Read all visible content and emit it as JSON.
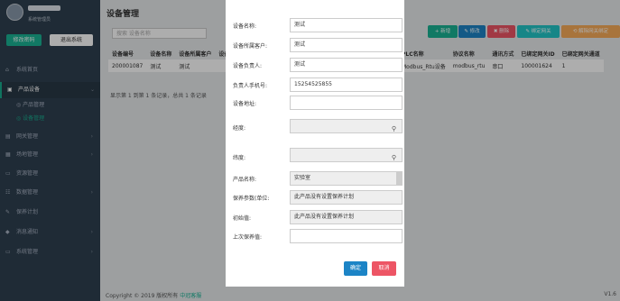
{
  "sidebar": {
    "role": "系统管理员",
    "edit_profile": "修改密码",
    "logout": "退出系统",
    "items": [
      {
        "icon": "home-icon",
        "glyph": "⌂",
        "label": "系统首页"
      },
      {
        "icon": "box-icon",
        "glyph": "▣",
        "label": "产品设备"
      },
      {
        "icon": "network-icon",
        "glyph": "▤",
        "label": "网关管理"
      },
      {
        "icon": "layers-icon",
        "glyph": "▦",
        "label": "场地管理"
      },
      {
        "icon": "monitor-icon",
        "glyph": "▭",
        "label": "资源管理"
      },
      {
        "icon": "grid-icon",
        "glyph": "☷",
        "label": "数据管理"
      },
      {
        "icon": "wrench-icon",
        "glyph": "✎",
        "label": "保养计划"
      },
      {
        "icon": "bell-icon",
        "glyph": "◆",
        "label": "消息通知"
      },
      {
        "icon": "desktop-icon",
        "glyph": "▭",
        "label": "系统管理"
      }
    ],
    "sub_items": [
      {
        "label": "产品管理"
      },
      {
        "label": "设备管理"
      }
    ]
  },
  "main": {
    "title": "设备管理",
    "search_placeholder": "搜索 设备名称",
    "toolbar": {
      "add": "+ 新增",
      "edit": "✎ 修改",
      "delete": "✖ 删除",
      "bind": "✎ 绑定网关",
      "unbind": "⟲ 解除网关绑定"
    },
    "columns_left": [
      "设备编号",
      "设备名称",
      "设备所属客户",
      "设备负责人"
    ],
    "row_left": [
      "200001087",
      "测试",
      "测试",
      ""
    ],
    "columns_right": [
      "PLC名称",
      "协议名称",
      "通讯方式",
      "已绑定网关ID",
      "已绑定网关通道"
    ],
    "row_right": [
      "Modbus_Rtu设备",
      "modbus_rtu",
      "串口",
      "100001624",
      "1"
    ],
    "pager": "显示第 1 到第 1 条记录，总共 1 条记录",
    "footer_prefix": "Copyright © 2019 版权所有 ",
    "footer_link": "中冠客服",
    "version": "V1.6"
  },
  "modal": {
    "fields": [
      {
        "label": "设备名称:",
        "value": "测试"
      },
      {
        "label": "设备所属客户:",
        "value": "测试"
      },
      {
        "label": "设备负责人:",
        "value": "测试"
      },
      {
        "label": "负责人手机号:",
        "value": "15254525855"
      },
      {
        "label": "设备地址:",
        "value": ""
      },
      {
        "label": "经度:",
        "value": ""
      },
      {
        "label": "纬度:",
        "value": ""
      },
      {
        "label": "产品名称:",
        "value": "实验室"
      },
      {
        "label": "保养参数(单位:",
        "value": "此产品没有设置保养计划"
      },
      {
        "label": "初始值:",
        "value": "此产品没有设置保养计划"
      },
      {
        "label": "上次保养值:",
        "value": ""
      }
    ],
    "confirm": "确定",
    "cancel": "取消"
  },
  "colors": {
    "sidebar_bg": "#2f4050",
    "accent": "#1ab394",
    "add_btn": "#1ab394",
    "edit_btn": "#1c84c6",
    "delete_btn": "#ed5565",
    "bind_btn": "#23c6c8",
    "unbind_btn": "#f8ac59",
    "confirm_btn": "#1c84c6",
    "cancel_btn": "#ed5565"
  }
}
